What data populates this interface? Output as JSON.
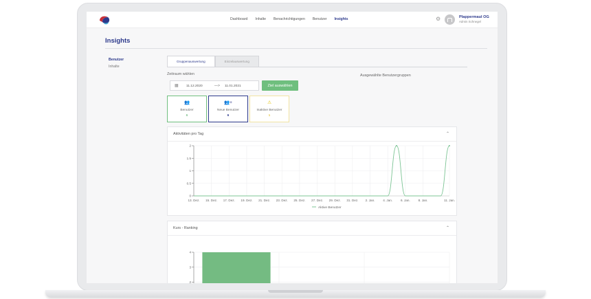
{
  "nav": {
    "items": [
      "Dashboard",
      "Inhalte",
      "Benachrichtigungen",
      "Benutzer",
      "Insights"
    ],
    "active": "Insights",
    "org_name": "Plappermaul OG",
    "user_role": "Admin Schnegel"
  },
  "page": {
    "title": "Insights"
  },
  "sidebar": {
    "items": [
      "Benutzer",
      "Inhalte"
    ]
  },
  "tabs": [
    "Gruppenauswertung",
    "Einzelauswertung"
  ],
  "filters": {
    "zeitraum_label": "Zeitraum wählen",
    "date_from": "11.12.2020",
    "date_to": "11.01.2021",
    "arrow": "—>",
    "button_label": "Ziel auswählen",
    "selected_groups_label": "Ausgewählte Benutzergruppen"
  },
  "stats": [
    {
      "label": "Benutzer",
      "value": "6",
      "icon": "users-icon"
    },
    {
      "label": "Neue Benutzer",
      "value": "6",
      "icon": "user-add-icon"
    },
    {
      "label": "Inaktive Benutzer",
      "value": "1",
      "icon": "warning-icon"
    }
  ],
  "chart_data": [
    {
      "type": "line",
      "title": "Aktivitäten pro Tag",
      "x": [
        "13. Dez.",
        "15. Dez.",
        "17. Dez.",
        "19. Dez.",
        "21. Dez.",
        "23. Dez.",
        "25. Dez.",
        "27. Dez.",
        "29. Dez.",
        "31. Dez.",
        "2. Jan.",
        "4. Jan.",
        "6. Jan.",
        "8. Jan.",
        "11. Jan."
      ],
      "series": [
        {
          "name": "Aktive Benutzer",
          "points": [
            [
              "13. Dez.",
              0
            ],
            [
              "15. Dez.",
              0
            ],
            [
              "17. Dez.",
              0
            ],
            [
              "19. Dez.",
              0
            ],
            [
              "21. Dez.",
              0
            ],
            [
              "23. Dez.",
              0
            ],
            [
              "25. Dez.",
              0
            ],
            [
              "27. Dez.",
              0
            ],
            [
              "29. Dez.",
              0
            ],
            [
              "31. Dez.",
              0
            ],
            [
              "2. Jan.",
              0
            ],
            [
              "4. Jan.",
              0
            ],
            [
              "5. Jan.",
              2
            ],
            [
              "6. Jan.",
              0
            ],
            [
              "8. Jan.",
              0
            ],
            [
              "10. Jan.",
              0
            ],
            [
              "11. Jan.",
              2
            ]
          ],
          "color": "#7cc494"
        }
      ],
      "yticks": [
        "0",
        "0.5",
        "1",
        "1.5",
        "2"
      ],
      "ylim": [
        0,
        2
      ],
      "legend": "bottom"
    },
    {
      "type": "bar",
      "title": "Kurs - Ranking",
      "categories": [
        "",
        "",
        ""
      ],
      "values": [
        4,
        0.08,
        0.08
      ],
      "yticks": [
        "1",
        "2",
        "3",
        "4"
      ],
      "ylim": [
        1,
        4
      ],
      "color": "#74bb82"
    }
  ]
}
